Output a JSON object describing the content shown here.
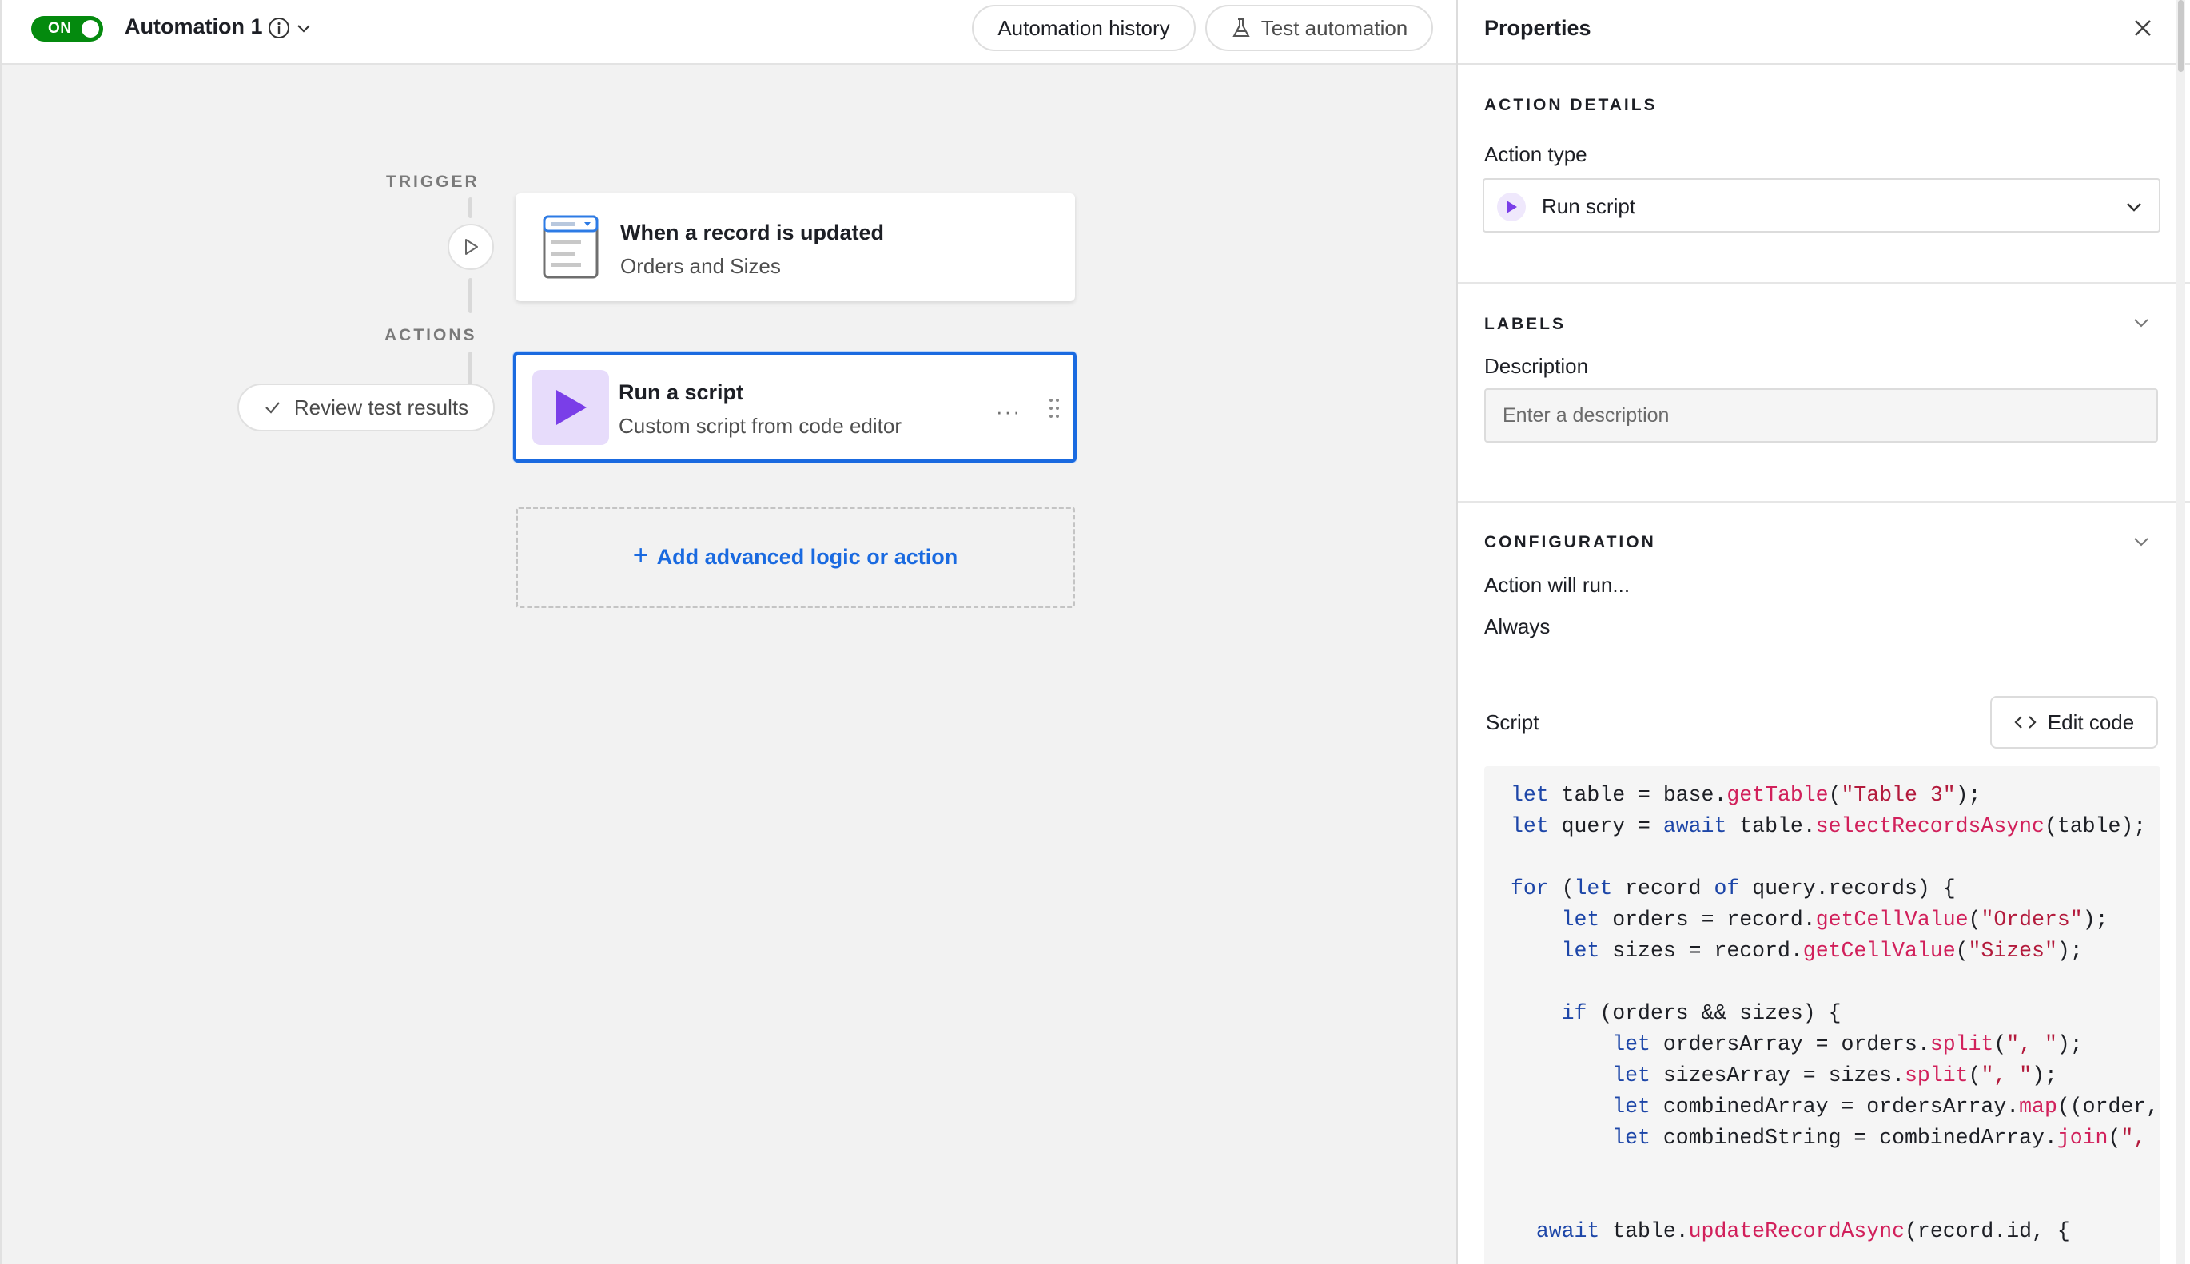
{
  "header": {
    "toggle_label": "ON",
    "automation_name": "Automation 1",
    "history_button": "Automation history",
    "test_button": "Test automation"
  },
  "flow": {
    "trigger_label": "TRIGGER",
    "actions_label": "ACTIONS",
    "trigger_card": {
      "title": "When a record is updated",
      "subtitle": "Orders and Sizes"
    },
    "action_card": {
      "title": "Run a script",
      "subtitle": "Custom script from code editor",
      "more": "···"
    },
    "review_button": "Review test results",
    "add_button": "Add advanced logic or action"
  },
  "panel": {
    "title": "Properties",
    "action_details": {
      "heading": "ACTION DETAILS",
      "action_type_label": "Action type",
      "action_type_value": "Run script"
    },
    "labels": {
      "heading": "LABELS",
      "description_label": "Description",
      "description_placeholder": "Enter a description",
      "description_value": ""
    },
    "configuration": {
      "heading": "CONFIGURATION",
      "run_label": "Action will run...",
      "run_value": "Always"
    },
    "script": {
      "label": "Script",
      "edit_button": "Edit code",
      "code_lines": [
        "let table = base.getTable(\"Table 3\");",
        "let query = await table.selectRecordsAsync(table);",
        "",
        "for (let record of query.records) {",
        "    let orders = record.getCellValue(\"Orders\");",
        "    let sizes = record.getCellValue(\"Sizes\");",
        "",
        "    if (orders && sizes) {",
        "        let ordersArray = orders.split(\", \");",
        "        let sizesArray = sizes.split(\", \");",
        "        let combinedArray = ordersArray.map((order,",
        "        let combinedString = combinedArray.join(\", '",
        "",
        "",
        "  await table.updateRecordAsync(record.id, {"
      ]
    }
  },
  "icons": {
    "info": "info-icon",
    "chevron": "chevron-down-icon",
    "flask": "flask-icon",
    "play": "play-icon",
    "record": "record-table-icon",
    "script": "script-play-icon",
    "check": "check-icon",
    "plus": "plus-icon",
    "close": "close-icon",
    "code": "code-icon"
  },
  "colors": {
    "toggle_on": "#048a0e",
    "accent_blue": "#1a6ae0",
    "script_purple": "#7a3ee8",
    "keyword": "#1d46a8",
    "function": "#d1205b",
    "string": "#b31a3c"
  }
}
